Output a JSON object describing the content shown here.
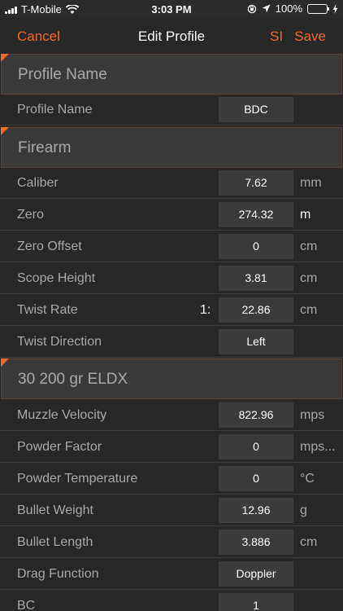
{
  "status_bar": {
    "carrier": "T-Mobile",
    "time": "3:03 PM",
    "battery": "100%",
    "battery_color": "#4cd964",
    "icons": [
      "signal-icon",
      "wifi-icon",
      "rotation-lock-icon",
      "location-icon",
      "battery-icon",
      "charging-icon"
    ]
  },
  "nav": {
    "cancel": "Cancel",
    "title": "Edit Profile",
    "units": "SI",
    "save": "Save",
    "accent_color": "#ef6b2c"
  },
  "sections": {
    "profile": {
      "title": "Profile Name",
      "rows": [
        {
          "label": "Profile Name",
          "value": "BDC",
          "unit": ""
        }
      ]
    },
    "firearm": {
      "title": "Firearm",
      "rows": [
        {
          "label": "Caliber",
          "value": "7.62",
          "unit": "mm"
        },
        {
          "label": "Zero",
          "value": "274.32",
          "unit": "m"
        },
        {
          "label": "Zero Offset",
          "value": "0",
          "unit": "cm"
        },
        {
          "label": "Scope Height",
          "value": "3.81",
          "unit": "cm"
        },
        {
          "label": "Twist Rate",
          "prefix": "1:",
          "value": "22.86",
          "unit": "cm"
        },
        {
          "label": "Twist Direction",
          "value": "Left",
          "unit": ""
        }
      ]
    },
    "ammo": {
      "title": "30 200 gr ELDX",
      "rows": [
        {
          "label": "Muzzle Velocity",
          "value": "822.96",
          "unit": "mps"
        },
        {
          "label": "Powder Factor",
          "value": "0",
          "unit": "mps..."
        },
        {
          "label": "Powder Temperature",
          "value": "0",
          "unit": "°C"
        },
        {
          "label": "Bullet Weight",
          "value": "12.96",
          "unit": "g"
        },
        {
          "label": "Bullet Length",
          "value": "3.886",
          "unit": "cm"
        },
        {
          "label": "Drag Function",
          "value": "Doppler",
          "unit": ""
        },
        {
          "label": "BC",
          "value": "1",
          "unit": ""
        }
      ]
    }
  }
}
